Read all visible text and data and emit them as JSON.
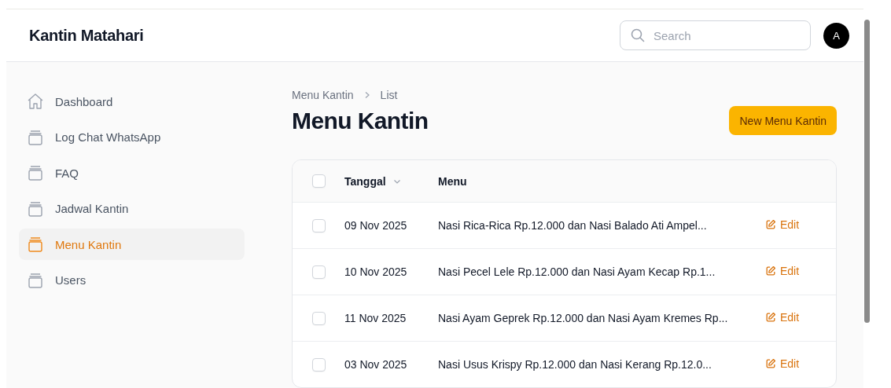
{
  "header": {
    "brand": "Kantin Matahari",
    "search": {
      "placeholder": "Search"
    },
    "avatar": "A"
  },
  "sidebar": {
    "items": [
      {
        "label": "Dashboard",
        "kind": "home",
        "selected": false
      },
      {
        "label": "Log Chat WhatsApp",
        "kind": "tray",
        "selected": false
      },
      {
        "label": "FAQ",
        "kind": "tray",
        "selected": false
      },
      {
        "label": "Jadwal Kantin",
        "kind": "tray",
        "selected": false
      },
      {
        "label": "Menu Kantin",
        "kind": "tray",
        "selected": true
      },
      {
        "label": "Users",
        "kind": "tray",
        "selected": false
      }
    ]
  },
  "breadcrumb": [
    "Menu Kantin",
    "List"
  ],
  "title": "Menu Kantin",
  "new_button": "New Menu Kantin",
  "table": {
    "select_all": {
      "checked": false
    },
    "columns": [
      {
        "label": "Tanggal",
        "sortable": true
      },
      {
        "label": "Menu",
        "sortable": false
      }
    ],
    "rows": [
      {
        "checked": false,
        "date": "09 Nov 2025",
        "menu": "Nasi Rica-Rica Rp.12.000 dan Nasi Balado Ati Ampel...",
        "action": "Edit"
      },
      {
        "checked": false,
        "date": "10 Nov 2025",
        "menu": "Nasi Pecel Lele Rp.12.000 dan Nasi Ayam Kecap Rp.1...",
        "action": "Edit"
      },
      {
        "checked": false,
        "date": "11 Nov 2025",
        "menu": "Nasi Ayam Geprek Rp.12.000 dan Nasi Ayam Kremes Rp...",
        "action": "Edit"
      },
      {
        "checked": false,
        "date": "03 Nov 2025",
        "menu": "Nasi Usus Krispy Rp.12.000 dan Nasi Kerang Rp.12.0...",
        "action": "Edit"
      }
    ]
  }
}
